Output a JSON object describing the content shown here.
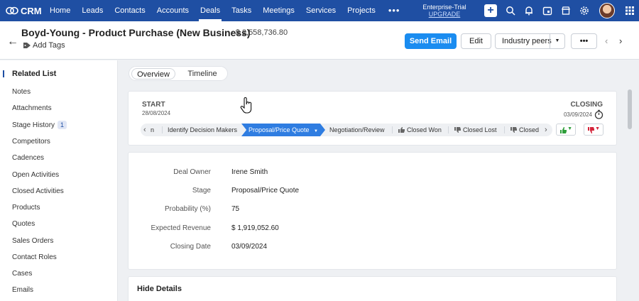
{
  "topnav": {
    "brand": "CRM",
    "items": [
      "Home",
      "Leads",
      "Contacts",
      "Accounts",
      "Deals",
      "Tasks",
      "Meetings",
      "Services",
      "Projects"
    ],
    "active": "Deals",
    "more": "•••",
    "trial_line1": "Enterprise-Trial",
    "trial_line2": "UPGRADE",
    "icons": [
      "plus-icon",
      "search-icon",
      "bell-icon",
      "calendar-icon",
      "store-icon",
      "gear-icon",
      "avatar",
      "apps-grid-icon"
    ]
  },
  "header": {
    "title": "Boyd-Young - Product Purchase (New Business)",
    "amount": "- $ 2,558,736.80",
    "add_tags": "Add Tags",
    "send_email": "Send Email",
    "edit": "Edit",
    "industry_peers": "Industry peers",
    "more": "•••"
  },
  "sidebar": {
    "heading": "Related List",
    "items": [
      {
        "label": "Notes"
      },
      {
        "label": "Attachments"
      },
      {
        "label": "Stage History",
        "badge": "1"
      },
      {
        "label": "Competitors"
      },
      {
        "label": "Cadences"
      },
      {
        "label": "Open Activities"
      },
      {
        "label": "Closed Activities"
      },
      {
        "label": "Products"
      },
      {
        "label": "Quotes"
      },
      {
        "label": "Sales Orders"
      },
      {
        "label": "Contact Roles"
      },
      {
        "label": "Cases"
      },
      {
        "label": "Emails"
      }
    ]
  },
  "tabs": {
    "overview": "Overview",
    "timeline": "Timeline"
  },
  "stage": {
    "start_label": "START",
    "start_date": "28/08/2024",
    "closing_label": "CLOSING",
    "closing_date": "03/09/2024",
    "stages": [
      "n",
      "Identify Decision Makers",
      "Proposal/Price Quote",
      "Negotiation/Review",
      "Closed Won",
      "Closed Lost",
      "Closed"
    ],
    "current": "Proposal/Price Quote",
    "accent": "#2f7de1",
    "won_color": "#2e9e3a",
    "lost_color": "#d4253b"
  },
  "details": {
    "rows": [
      {
        "label": "Deal Owner",
        "value": "Irene Smith"
      },
      {
        "label": "Stage",
        "value": "Proposal/Price Quote"
      },
      {
        "label": "Probability (%)",
        "value": "75"
      },
      {
        "label": "Expected Revenue",
        "value": "$ 1,919,052.60"
      },
      {
        "label": "Closing Date",
        "value": "03/09/2024"
      }
    ]
  },
  "hide_details": "Hide Details"
}
